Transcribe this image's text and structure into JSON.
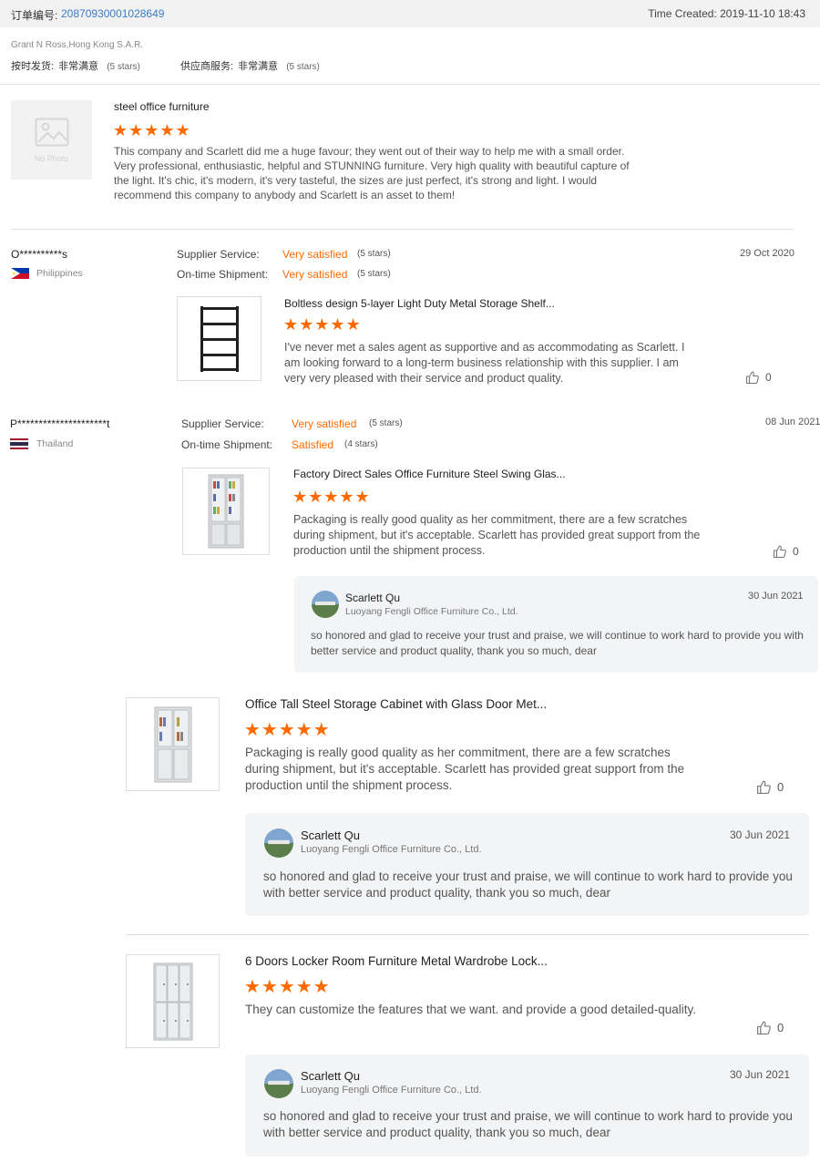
{
  "order": {
    "label": "订单编号:",
    "number": "20870930001028649",
    "time_created": "Time Created: 2019-11-10 18:43"
  },
  "buyer": {
    "name": "Grant N Ross,Hong Kong S.A.R.",
    "ratings": [
      {
        "label": "按时发货:",
        "value": "非常满意",
        "stars": "(5 stars)"
      },
      {
        "label": "供应商服务:",
        "value": "非常满意",
        "stars": "(5 stars)"
      }
    ]
  },
  "first_review": {
    "no_photo": "No Photo",
    "title": "steel office furniture",
    "rating": 5,
    "text": "This company and Scarlett did me a huge favour; they went out of their way to help me with a small order. Very professional, enthusiastic, helpful and STUNNING furniture. Very high quality with beautiful capture of the light. It's chic, it's modern, it's very tasteful, the sizes are just perfect, it's strong and light. I would recommend this company to anybody and Scarlett is an asset to them!"
  },
  "reviews": [
    {
      "reviewer": "O**********s",
      "country": "Philippines",
      "date": "29 Oct 2020",
      "services": [
        {
          "label": "Supplier Service:",
          "value": "Very satisfied",
          "stars": "(5 stars)"
        },
        {
          "label": "On-time Shipment:",
          "value": "Very satisfied",
          "stars": "(5 stars)"
        }
      ],
      "products": [
        {
          "title": "Boltless design 5-layer Light Duty Metal Storage Shelf...",
          "rating": 5,
          "text": "I've never met a sales agent as supportive and as accommodating as Scarlett. I am looking forward to a long-term business relationship with this supplier. I am very very pleased with their service and product quality.",
          "likes": "0"
        }
      ]
    },
    {
      "reviewer": "P*********************t",
      "country": "Thailand",
      "date": "08 Jun 2021",
      "services": [
        {
          "label": "Supplier Service:",
          "value": "Very satisfied",
          "stars": "(5 stars)"
        },
        {
          "label": "On-time Shipment:",
          "value": "Satisfied",
          "stars": "(4 stars)"
        }
      ],
      "products": [
        {
          "title": "Factory Direct Sales Office Furniture Steel Swing Glas...",
          "rating": 5,
          "text": "Packaging is really good quality as her commitment, there are a few scratches during shipment, but it's acceptable. Scarlett has provided great support from the production until the shipment process.",
          "likes": "0",
          "reply": {
            "name": "Scarlett Qu",
            "company": "Luoyang Fengli Office Furniture Co., Ltd.",
            "date": "30 Jun 2021",
            "text": "so honored and glad to receive your trust and praise, we will continue to work hard to provide you with better service and product quality, thank you so much, dear"
          }
        },
        {
          "title": "Office Tall Steel Storage Cabinet with Glass Door Met...",
          "rating": 5,
          "text": "Packaging is really good quality as her commitment, there are a few scratches during shipment, but it's acceptable. Scarlett has provided great support from the production until the shipment process.",
          "likes": "0",
          "reply": {
            "name": "Scarlett Qu",
            "company": "Luoyang Fengli Office Furniture Co., Ltd.",
            "date": "30 Jun 2021",
            "text": "so honored and glad to receive your trust and praise, we will continue to work hard to provide you with better service and product quality, thank you so much, dear"
          }
        },
        {
          "title": "6 Doors Locker Room Furniture Metal Wardrobe Lock...",
          "rating": 5,
          "text": "They can customize the features that we want. and provide a good detailed-quality.",
          "likes": "0",
          "reply": {
            "name": "Scarlett Qu",
            "company": "Luoyang Fengli Office Furniture Co., Ltd.",
            "date": "30 Jun 2021",
            "text": "so honored and glad to receive your trust and praise, we will continue to work hard to provide you with better service and product quality, thank you so much, dear"
          }
        }
      ]
    }
  ],
  "icons": {
    "star": "star-icon",
    "like": "thumbs-up-icon",
    "photo": "image-placeholder-icon"
  },
  "colors": {
    "accent": "#ff6a00",
    "link": "#3a7bc8"
  }
}
